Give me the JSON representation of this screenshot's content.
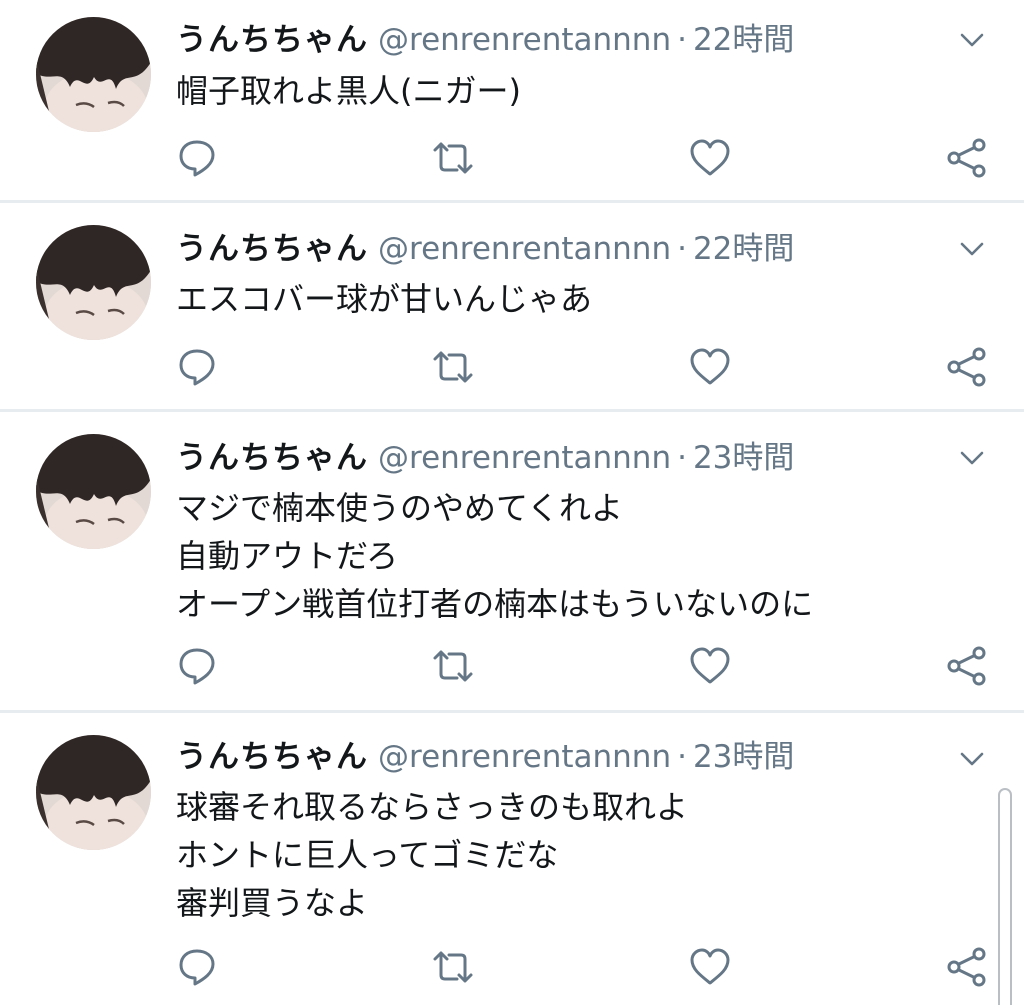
{
  "tweets": [
    {
      "name": "うんちちゃん",
      "handle": "@renrenrentannnn",
      "separator": "·",
      "time": "22時間",
      "lines": [
        "帽子取れよ黒人(ニガー)"
      ]
    },
    {
      "name": "うんちちゃん",
      "handle": "@renrenrentannnn",
      "separator": "·",
      "time": "22時間",
      "lines": [
        "エスコバー球が甘いんじゃあ"
      ]
    },
    {
      "name": "うんちちゃん",
      "handle": "@renrenrentannnn",
      "separator": "·",
      "time": "23時間",
      "lines": [
        "マジで楠本使うのやめてくれよ",
        "自動アウトだろ",
        "オープン戦首位打者の楠本はもういないのに"
      ]
    },
    {
      "name": "うんちちゃん",
      "handle": "@renrenrentannnn",
      "separator": "·",
      "time": "23時間",
      "lines": [
        "球審それ取るならさっきのも取れよ",
        "ホントに巨人ってゴミだな",
        "審判買うなよ"
      ]
    }
  ],
  "icons": {
    "menu": "chevron-down-icon",
    "reply": "reply-icon",
    "retweet": "retweet-icon",
    "like": "heart-icon",
    "share": "share-icon"
  },
  "colors": {
    "text": "#14171a",
    "secondary": "#657786",
    "divider": "#e6ecf0"
  }
}
